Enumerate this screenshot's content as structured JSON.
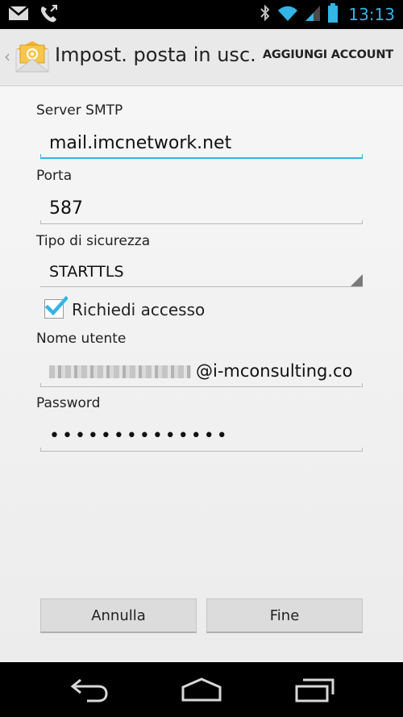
{
  "status_bar": {
    "time": "13:13",
    "icons": [
      "gmail-icon",
      "missed-call-icon",
      "bluetooth-icon",
      "wifi-icon",
      "signal-icon",
      "battery-icon"
    ],
    "accent_color": "#33b5e5"
  },
  "action_bar": {
    "up_caret": "‹",
    "title": "Impost. posta in usc...",
    "action_label": "AGGIUNGI ACCOUNT",
    "app_icon": "email-app-icon"
  },
  "form": {
    "smtp_label": "Server SMTP",
    "smtp_value": "mail.imcnetwork.net",
    "port_label": "Porta",
    "port_value": "587",
    "security_label": "Tipo di sicurezza",
    "security_value": "STARTTLS",
    "require_signin_label": "Richiedi accesso",
    "require_signin_checked": true,
    "username_label": "Nome utente",
    "username_visible_suffix": "@i-mconsulting.co",
    "password_label": "Password",
    "password_masked": "••••••••••••••"
  },
  "buttons": {
    "cancel": "Annulla",
    "done": "Fine"
  },
  "nav_bar": {
    "icons": [
      "back-icon",
      "home-icon",
      "recent-apps-icon"
    ]
  }
}
